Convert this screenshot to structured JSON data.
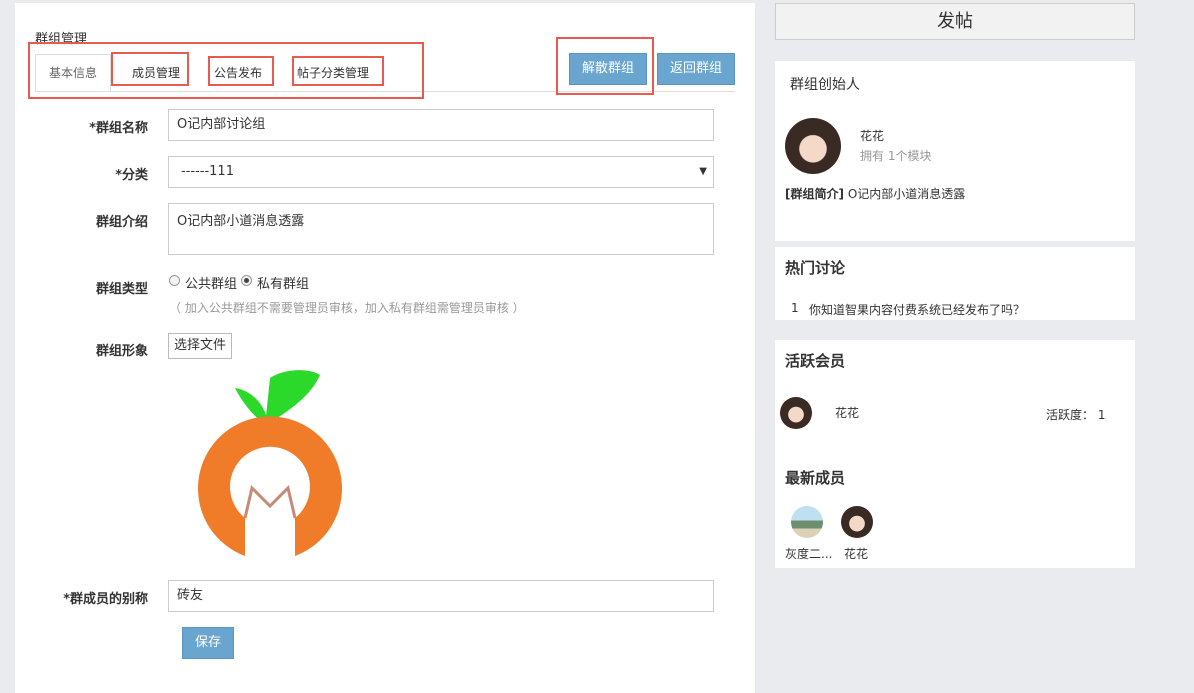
{
  "page_title": "群组管理",
  "tabs": [
    "基本信息",
    "成员管理",
    "公告发布",
    "帖子分类管理"
  ],
  "buttons": {
    "disband": "解散群组",
    "back": "返回群组",
    "save": "保存",
    "choose_file": "选择文件"
  },
  "form": {
    "name_label": "*群组名称",
    "name_value": "O记内部讨论组",
    "category_label": "*分类",
    "category_value": "------111",
    "intro_label": "群组介绍",
    "intro_value": "O记内部小道消息透露",
    "type_label": "群组类型",
    "type_public": "公共群组",
    "type_private": "私有群组",
    "type_hint": "（ 加入公共群组不需要管理员审核，加入私有群组需管理员审核 ）",
    "image_label": "群组形象",
    "alias_label": "*群成员的别称",
    "alias_value": "砖友"
  },
  "sidebar": {
    "post_button": "发帖",
    "founder": {
      "title": "群组创始人",
      "name": "花花",
      "modules": "拥有 1个模块",
      "intro_label": "[群组简介]",
      "intro_text": "O记内部小道消息透露"
    },
    "hot": {
      "title": "热门讨论",
      "items": [
        {
          "num": "1",
          "text": "你知道智果内容付费系统已经发布了吗？"
        }
      ]
    },
    "active": {
      "title": "活跃会员",
      "member_name": "花花",
      "activity_label": "活跃度：",
      "activity_value": "1"
    },
    "newest": {
      "title": "最新成员",
      "members": [
        "灰度二...",
        "花花"
      ]
    }
  },
  "colors": {
    "accent_blue": "#6aa5d0",
    "highlight_red": "#e95a4e",
    "orange_logo": "#f07c2a",
    "leaf_green": "#2bd92b"
  }
}
